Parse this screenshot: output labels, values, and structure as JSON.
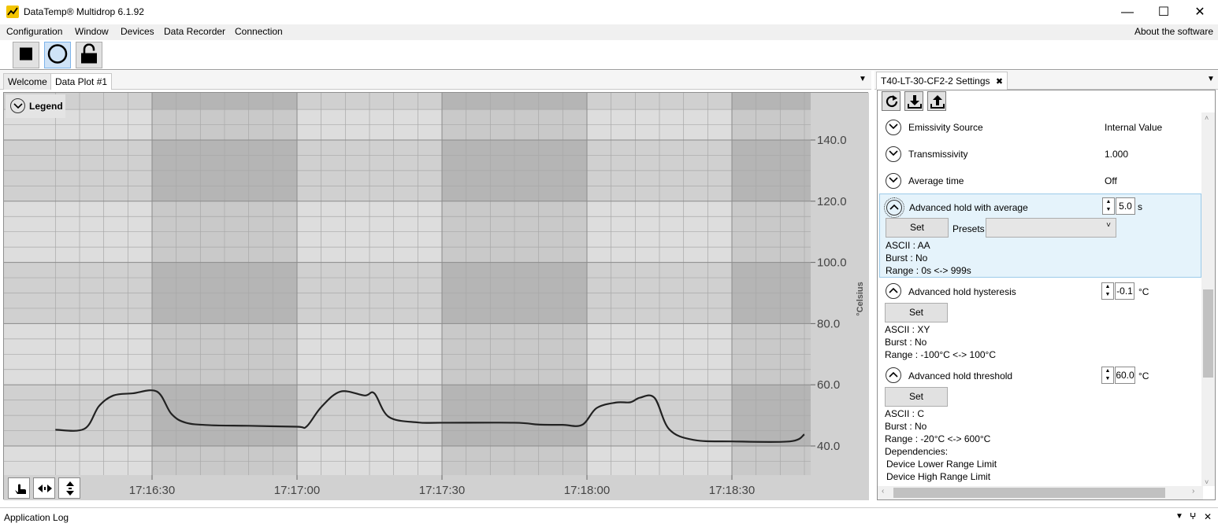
{
  "window": {
    "title": "DataTemp® Multidrop 6.1.92",
    "minimize": "—",
    "maximize": "☐",
    "close": "✕"
  },
  "menu": {
    "items": [
      "Configuration",
      "Window",
      "Devices",
      "Data Recorder",
      "Connection"
    ],
    "about": "About the software"
  },
  "toolbar": {
    "buttons": [
      "stop-icon",
      "record-circle-icon",
      "unlock-icon"
    ]
  },
  "tabs": {
    "left": [
      "Welcome",
      "Data Plot #1"
    ],
    "right": "T40-LT-30-CF2-2 Settings",
    "close_glyph": "✖",
    "menu_glyph": "▼"
  },
  "plot": {
    "legend_label": "Legend",
    "y_axis_label": "°Celsius",
    "y_ticks": [
      "140.0",
      "120.0",
      "100.0",
      "80.0",
      "60.0",
      "40.0"
    ],
    "x_ticks": [
      "17:16:30",
      "17:17:00",
      "17:17:30",
      "17:18:00",
      "17:18:30"
    ],
    "line_color": "#222222"
  },
  "chart_data": {
    "type": "line",
    "xlabel": "",
    "ylabel": "°Celsius",
    "ylim": [
      29,
      152
    ],
    "y_ticks": [
      140,
      120,
      100,
      80,
      60,
      40
    ],
    "x_ticks": [
      "17:16:30",
      "17:17:00",
      "17:17:30",
      "17:18:00",
      "17:18:30"
    ],
    "series": [
      {
        "x": [
          "17:16:10",
          "17:16:16",
          "17:16:19",
          "17:16:22",
          "17:16:26",
          "17:16:31",
          "17:16:34",
          "17:16:37",
          "17:16:42",
          "17:16:50",
          "17:17:00",
          "17:17:02",
          "17:17:05",
          "17:17:09",
          "17:17:14",
          "17:17:16",
          "17:17:19",
          "17:17:25",
          "17:17:30",
          "17:17:45",
          "17:17:50",
          "17:17:55",
          "17:17:59",
          "17:18:02",
          "17:18:06",
          "17:18:09",
          "17:18:11",
          "17:18:14",
          "17:18:17",
          "17:18:22",
          "17:18:30",
          "17:18:42",
          "17:18:45"
        ],
        "y": [
          45.3,
          45.6,
          53,
          56.5,
          57.2,
          57.8,
          50.5,
          47.6,
          46.8,
          46.6,
          46.3,
          46.4,
          52.7,
          57.8,
          56.5,
          57.2,
          49.5,
          47.7,
          47.6,
          47.6,
          47,
          46.9,
          46.9,
          52.4,
          54.2,
          54.3,
          55.8,
          55.7,
          45.5,
          42,
          41.5,
          41.5,
          43.8
        ]
      }
    ]
  },
  "plot_nav": {
    "buttons": [
      "pan-hand-icon",
      "horizontal-arrows-icon",
      "vertical-arrows-icon"
    ]
  },
  "settings": {
    "toolbar": [
      "refresh-icon",
      "download-icon",
      "upload-icon"
    ],
    "rows": [
      {
        "label": "Emissivity Source",
        "value": "Internal Value"
      },
      {
        "label": "Transmissivity",
        "value": "1.000"
      },
      {
        "label": "Average time",
        "value": "Off"
      }
    ],
    "expanded": [
      {
        "label": "Advanced hold with average",
        "value": "5.0",
        "unit": "s",
        "set": "Set",
        "presets_label": "Presets",
        "info": [
          "ASCII : AA",
          "Burst : No",
          "Range : 0s <-> 999s"
        ]
      },
      {
        "label": "Advanced hold hysteresis",
        "value": "-0.1",
        "unit": "°C",
        "set": "Set",
        "info": [
          "ASCII : XY",
          "Burst : No",
          "Range : -100°C <-> 100°C"
        ]
      },
      {
        "label": "Advanced hold threshold",
        "value": "60.0",
        "unit": "°C",
        "set": "Set",
        "info": [
          "ASCII : C",
          "Burst : No",
          "Range : -20°C <-> 600°C",
          "Dependencies:",
          "Device Lower Range Limit",
          "Device High Range Limit"
        ]
      }
    ]
  },
  "app_log": {
    "title": "Application Log",
    "controls": [
      "▼",
      "ⵖ",
      "✕"
    ]
  }
}
